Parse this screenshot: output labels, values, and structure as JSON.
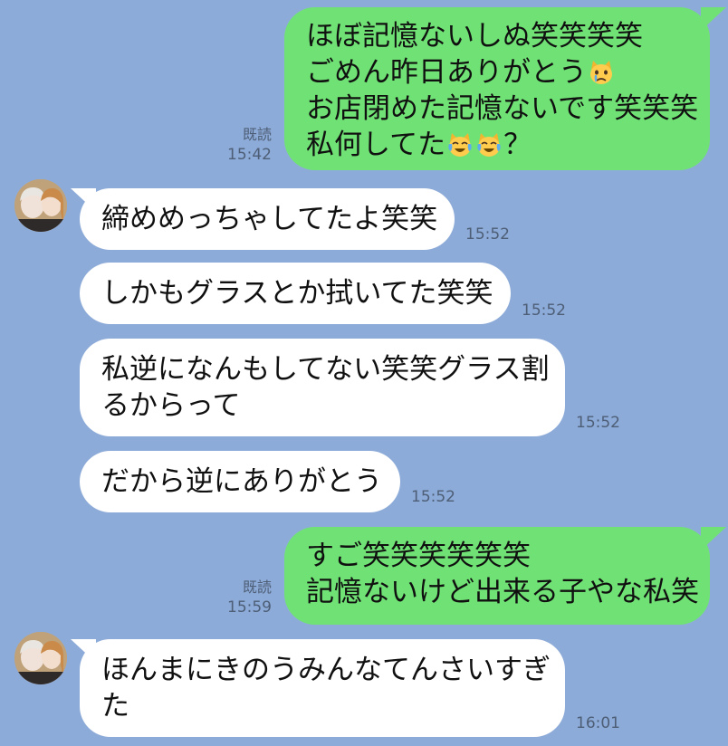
{
  "chat": {
    "messages": [
      {
        "direction": "outgoing",
        "lines": [
          "ほぼ記憶ないしぬ笑笑笑笑",
          "ごめん昨日ありがとう",
          "お店閉めた記憶ないです笑笑笑",
          "私何してた",
          "？"
        ],
        "emojis": [
          "crying-cat-face",
          "cat-face-with-tears-of-joy",
          "cat-face-with-tears-of-joy"
        ],
        "read_label": "既読",
        "time": "15:42"
      },
      {
        "direction": "incoming",
        "lines": [
          "締めめっちゃしてたよ笑笑"
        ],
        "time": "15:52"
      },
      {
        "direction": "incoming",
        "lines": [
          "しかもグラスとか拭いてた笑笑"
        ],
        "time": "15:52"
      },
      {
        "direction": "incoming",
        "lines": [
          "私逆になんもしてない笑笑グラス割",
          "るからって"
        ],
        "time": "15:52"
      },
      {
        "direction": "incoming",
        "lines": [
          "だから逆にありがとう"
        ],
        "time": "15:52"
      },
      {
        "direction": "outgoing",
        "lines": [
          "すご笑笑笑笑笑笑",
          "記憶ないけど出来る子やな私笑"
        ],
        "read_label": "既読",
        "time": "15:59"
      },
      {
        "direction": "incoming",
        "lines": [
          "ほんまにきのうみんなてんさいすぎ",
          "た"
        ],
        "time": "16:01"
      }
    ]
  },
  "colors": {
    "background": "#8dabd8",
    "outgoing_bubble": "#70e275",
    "incoming_bubble": "#ffffff",
    "meta_text": "#4d5e76"
  }
}
